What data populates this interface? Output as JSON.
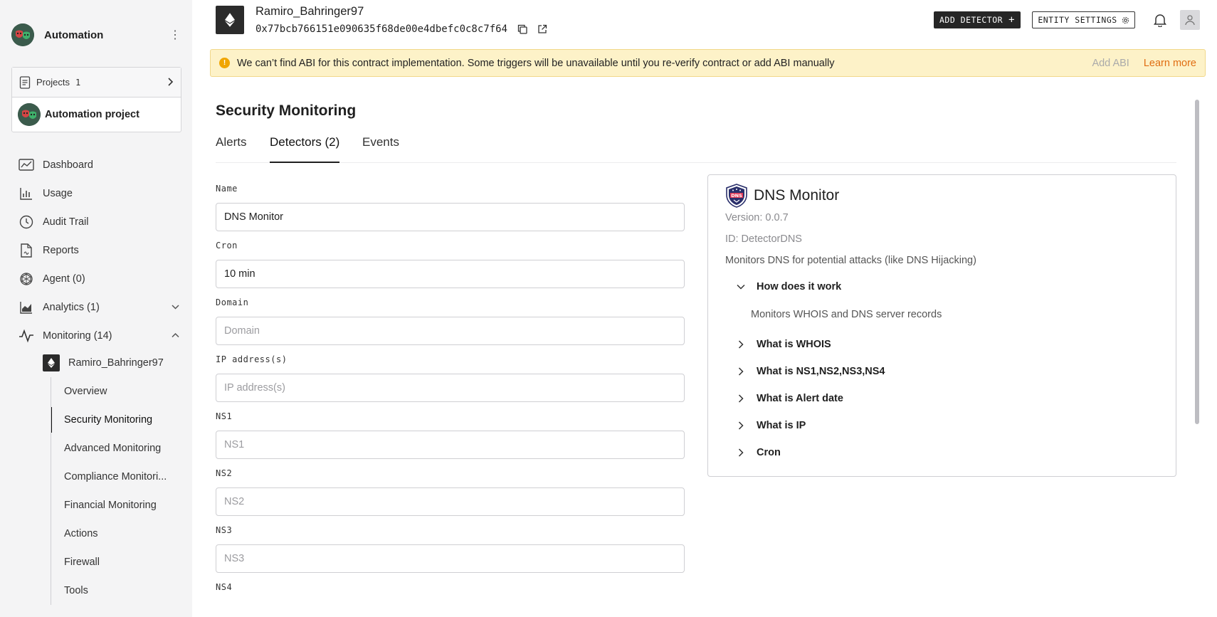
{
  "sidebar": {
    "org_name": "Automation",
    "projects_label": "Projects",
    "projects_count": "1",
    "project_name": "Automation project",
    "nav": [
      {
        "label": "Dashboard",
        "icon": "dashboard-icon"
      },
      {
        "label": "Usage",
        "icon": "bar-chart-icon"
      },
      {
        "label": "Audit Trail",
        "icon": "clock-icon"
      },
      {
        "label": "Reports",
        "icon": "document-icon"
      },
      {
        "label": "Agent (0)",
        "icon": "openai-icon"
      },
      {
        "label": "Analytics (1)",
        "icon": "area-chart-icon"
      },
      {
        "label": "Monitoring (14)",
        "icon": "pulse-icon"
      }
    ],
    "entity_name": "Ramiro_Bahringer97",
    "subnav": [
      "Overview",
      "Security Monitoring",
      "Advanced Monitoring",
      "Compliance Monitori...",
      "Financial Monitoring",
      "Actions",
      "Firewall",
      "Tools"
    ]
  },
  "header": {
    "entity_name": "Ramiro_Bahringer97",
    "address": "0x77bcb766151e090635f68de00e4dbefc0c8c7f64",
    "add_detector": "ADD DETECTOR",
    "entity_settings": "ENTITY SETTINGS"
  },
  "banner": {
    "text": "We can’t find ABI for this contract implementation. Some triggers will be unavailable until you re-verify contract or add ABI manually",
    "add_abi": "Add ABI",
    "learn_more": "Learn more"
  },
  "page": {
    "title": "Security Monitoring",
    "tabs": [
      "Alerts",
      "Detectors (2)",
      "Events"
    ]
  },
  "form": {
    "name_label": "Name",
    "name_value": "DNS Monitor",
    "cron_label": "Cron",
    "cron_value": "10 min",
    "domain_label": "Domain",
    "domain_placeholder": "Domain",
    "ip_label": "IP address(s)",
    "ip_placeholder": "IP address(s)",
    "ns1_label": "NS1",
    "ns1_placeholder": "NS1",
    "ns2_label": "NS2",
    "ns2_placeholder": "NS2",
    "ns3_label": "NS3",
    "ns3_placeholder": "NS3",
    "ns4_label": "NS4"
  },
  "detector": {
    "title": "DNS Monitor",
    "version": "Version: 0.0.7",
    "id": "ID: DetectorDNS",
    "description": "Monitors DNS for potential attacks (like DNS Hijacking)",
    "accordion": [
      {
        "label": "How does it work",
        "expanded": true,
        "body": "Monitors WHOIS and DNS server records"
      },
      {
        "label": "What is WHOIS"
      },
      {
        "label": "What is NS1,NS2,NS3,NS4"
      },
      {
        "label": "What is Alert date"
      },
      {
        "label": "What is IP"
      },
      {
        "label": "Cron"
      }
    ]
  },
  "colors": {
    "sidebar_bg": "#f4f4f5",
    "banner_bg": "#fdf2c8",
    "warning": "#f0a500",
    "learn_more": "#e06d12",
    "dark_button": "#262626"
  }
}
